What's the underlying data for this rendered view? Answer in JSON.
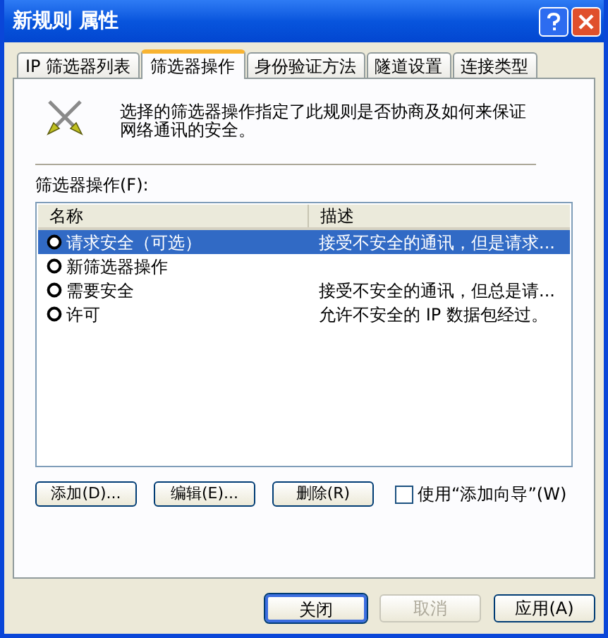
{
  "window": {
    "title": "新规则 属性"
  },
  "tabs": [
    {
      "label": "IP 筛选器列表",
      "selected": false
    },
    {
      "label": "筛选器操作",
      "selected": true
    },
    {
      "label": "身份验证方法",
      "selected": false
    },
    {
      "label": "隧道设置",
      "selected": false
    },
    {
      "label": "连接类型",
      "selected": false
    }
  ],
  "description": "选择的筛选器操作指定了此规则是否协商及如何来保证网络通讯的安全。",
  "list_label": "筛选器操作(F):",
  "table": {
    "columns": [
      "名称",
      "描述"
    ],
    "rows": [
      {
        "name": "请求安全（可选）",
        "description": "接受不安全的通讯，但是请求...",
        "selected": true
      },
      {
        "name": "新筛选器操作",
        "description": "",
        "selected": false
      },
      {
        "name": "需要安全",
        "description": "接受不安全的通讯，但总是请...",
        "selected": false
      },
      {
        "name": "许可",
        "description": "允许不安全的 IP 数据包经过。",
        "selected": false
      }
    ]
  },
  "actions": [
    {
      "label": "添加(D)..."
    },
    {
      "label": "编辑(E)..."
    },
    {
      "label": "删除(R)"
    }
  ],
  "wizard_checkbox": {
    "label": "使用“添加向导”(W)",
    "checked": false
  },
  "footer_buttons": [
    {
      "label": "关闭",
      "disabled": false,
      "default": true
    },
    {
      "label": "取消",
      "disabled": true,
      "default": false
    },
    {
      "label": "应用(A)",
      "disabled": false,
      "default": false
    }
  ]
}
